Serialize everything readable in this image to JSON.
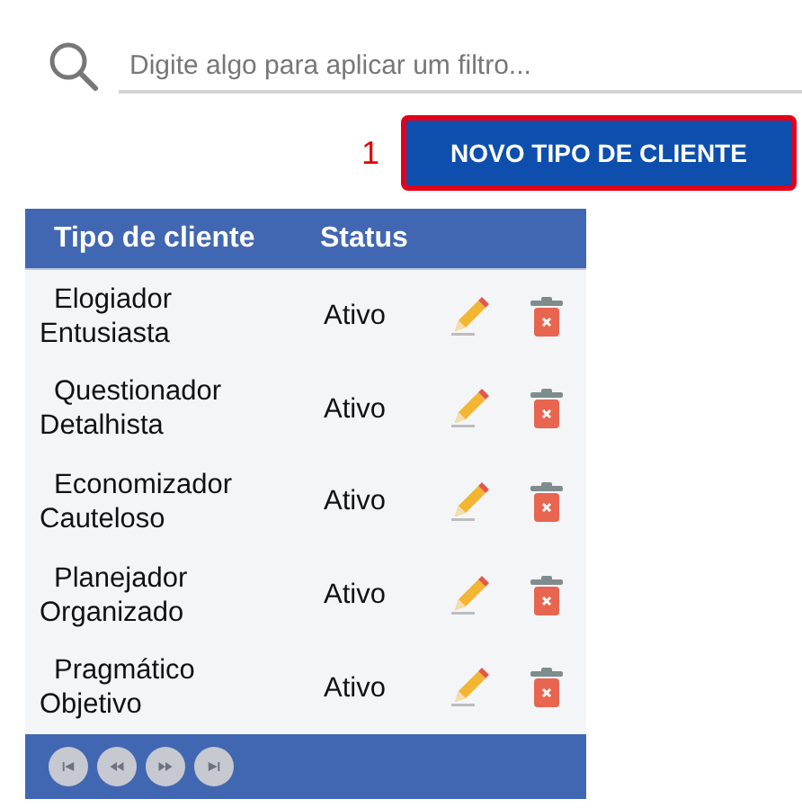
{
  "search": {
    "placeholder": "Digite algo para aplicar um filtro..."
  },
  "step_marker": "1",
  "new_button": "NOVO TIPO DE CLIENTE",
  "table": {
    "columns": [
      "Tipo de cliente",
      "Status"
    ],
    "rows": [
      {
        "name": "Elogiador Entusiasta",
        "status": "Ativo"
      },
      {
        "name": "Questionador Detalhista",
        "status": "Ativo"
      },
      {
        "name": "Economizador Cauteloso",
        "status": "Ativo"
      },
      {
        "name": "Planejador Organizado",
        "status": "Ativo"
      },
      {
        "name": "Pragmático Objetivo",
        "status": "Ativo"
      }
    ]
  },
  "pager": [
    {
      "kind": "first"
    },
    {
      "kind": "prev"
    },
    {
      "kind": "next"
    },
    {
      "kind": "last"
    }
  ]
}
